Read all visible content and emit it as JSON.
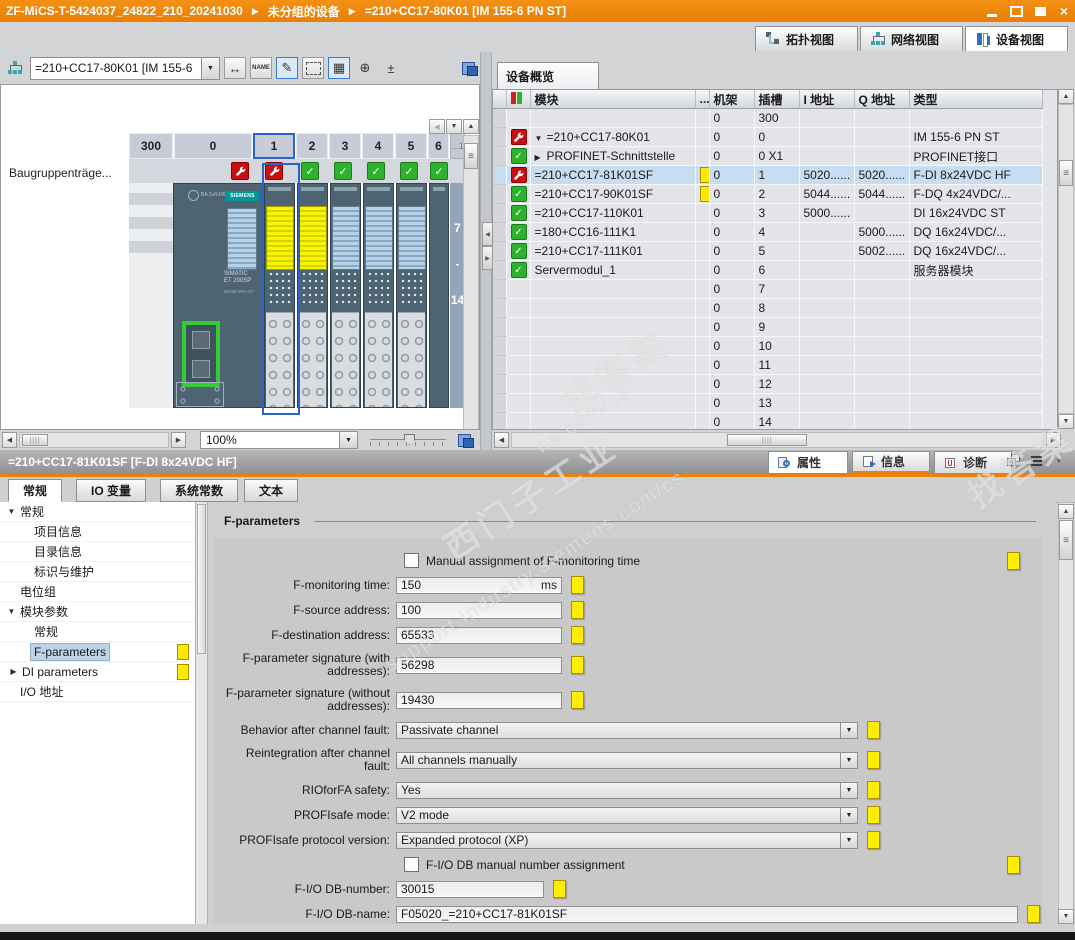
{
  "titlebar": {
    "breadcrumb": [
      "ZF-MiCS-T-5424037_24822_210_20241030",
      "未分组的设备",
      "=210+CC17-80K01 [IM 155-6 PN ST]"
    ],
    "separator": "▶"
  },
  "view_tabs": {
    "topology": "拓扑视图",
    "network": "网络视图",
    "device": "设备视图"
  },
  "device_toolbar": {
    "selector_value": "=210+CC17-80K01 [IM 155-6",
    "name_icon_text": "NAME",
    "zoom_value": "100%"
  },
  "rack": {
    "row_label": "Baugruppenträge...",
    "slot_headers": [
      "300",
      "0",
      "1",
      "2",
      "3",
      "4",
      "5",
      "6"
    ],
    "more_slots_label": "...1",
    "collapsed_slots": [
      "7",
      "-",
      "14"
    ],
    "logo": "SIEMENS",
    "im_text_line1": "SIMATIC",
    "im_text_line2": "ET 200SP",
    "im_text_line3": "IM155-6PN ST"
  },
  "overview": {
    "tab_label": "设备概览",
    "columns": {
      "module": "模块",
      "dots": "...",
      "rack": "机架",
      "slot": "插槽",
      "iaddr": "I 地址",
      "qaddr": "Q 地址",
      "type": "类型"
    },
    "rows": [
      {
        "name": "",
        "rack": "0",
        "slot": "300",
        "i": "",
        "q": "",
        "type": ""
      },
      {
        "name": "=210+CC17-80K01",
        "rack": "0",
        "slot": "0",
        "i": "",
        "q": "",
        "type": "IM 155-6 PN ST"
      },
      {
        "name": "PROFINET-Schnittstelle",
        "rack": "0",
        "slot": "0 X1",
        "i": "",
        "q": "",
        "type": "PROFINET接口"
      },
      {
        "name": "=210+CC17-81K01SF",
        "rack": "0",
        "slot": "1",
        "i": "5020......",
        "q": "5020......",
        "type": "F-DI 8x24VDC HF"
      },
      {
        "name": "=210+CC17-90K01SF",
        "rack": "0",
        "slot": "2",
        "i": "5044......",
        "q": "5044......",
        "type": "F-DQ 4x24VDC/..."
      },
      {
        "name": "=210+CC17-110K01",
        "rack": "0",
        "slot": "3",
        "i": "5000......",
        "q": "",
        "type": "DI 16x24VDC ST"
      },
      {
        "name": "=180+CC16-111K1",
        "rack": "0",
        "slot": "4",
        "i": "",
        "q": "5000......",
        "type": "DQ 16x24VDC/..."
      },
      {
        "name": "=210+CC17-111K01",
        "rack": "0",
        "slot": "5",
        "i": "",
        "q": "5002......",
        "type": "DQ 16x24VDC/..."
      },
      {
        "name": "Servermodul_1",
        "rack": "0",
        "slot": "6",
        "i": "",
        "q": "",
        "type": "服务器模块"
      },
      {
        "name": "",
        "rack": "0",
        "slot": "7",
        "i": "",
        "q": "",
        "type": ""
      },
      {
        "name": "",
        "rack": "0",
        "slot": "8",
        "i": "",
        "q": "",
        "type": ""
      },
      {
        "name": "",
        "rack": "0",
        "slot": "9",
        "i": "",
        "q": "",
        "type": ""
      },
      {
        "name": "",
        "rack": "0",
        "slot": "10",
        "i": "",
        "q": "",
        "type": ""
      },
      {
        "name": "",
        "rack": "0",
        "slot": "11",
        "i": "",
        "q": "",
        "type": ""
      },
      {
        "name": "",
        "rack": "0",
        "slot": "12",
        "i": "",
        "q": "",
        "type": ""
      },
      {
        "name": "",
        "rack": "0",
        "slot": "13",
        "i": "",
        "q": "",
        "type": ""
      },
      {
        "name": "",
        "rack": "0",
        "slot": "14",
        "i": "",
        "q": "",
        "type": ""
      }
    ]
  },
  "properties": {
    "title": "=210+CC17-81K01SF [F-DI 8x24VDC HF]",
    "right_tabs": {
      "properties": "属性",
      "info": "信息",
      "diagnostics": "诊断"
    },
    "tabs": {
      "general": "常规",
      "io_tags": "IO 变量",
      "system_constants": "系统常数",
      "texts": "文本"
    },
    "tree": [
      {
        "label": "常规"
      },
      {
        "label": "项目信息"
      },
      {
        "label": "目录信息"
      },
      {
        "label": "标识与维护"
      },
      {
        "label": "电位组"
      },
      {
        "label": "模块参数"
      },
      {
        "label": "常规"
      },
      {
        "label": "F-parameters"
      },
      {
        "label": "DI parameters"
      },
      {
        "label": "I/O 地址"
      }
    ],
    "form": {
      "heading": "F-parameters",
      "checkbox_monitoring": "Manual assignment of F-monitoring time",
      "fields": [
        {
          "label": "F-monitoring time:",
          "value": "150",
          "unit": "ms"
        },
        {
          "label": "F-source address:",
          "value": "100"
        },
        {
          "label": "F-destination address:",
          "value": "65533"
        },
        {
          "label": "F-parameter signature (with addresses):",
          "value": "56298"
        },
        {
          "label": "F-parameter signature (without addresses):",
          "value": "19430"
        },
        {
          "label": "Behavior after channel fault:",
          "value": "Passivate channel"
        },
        {
          "label": "Reintegration after channel fault:",
          "value": "All channels manually"
        },
        {
          "label": "RIOforFA safety:",
          "value": "Yes"
        },
        {
          "label": "PROFIsafe mode:",
          "value": "V2 mode"
        },
        {
          "label": "PROFIsafe protocol version:",
          "value": "Expanded protocol (XP)"
        },
        {
          "label": "F-I/O DB-number:",
          "value": "30015"
        },
        {
          "label": "F-I/O DB-name:",
          "value": "F05020_=210+CC17-81K01SF"
        }
      ],
      "checkbox_db": "F-I/O DB manual number assignment"
    }
  },
  "watermarks": {
    "w1": "找答案",
    "w2": "ns.com/cs",
    "w3": "西门子工业",
    "w4": "support.industry.siemens.com/cs",
    "w5": "找答案"
  }
}
